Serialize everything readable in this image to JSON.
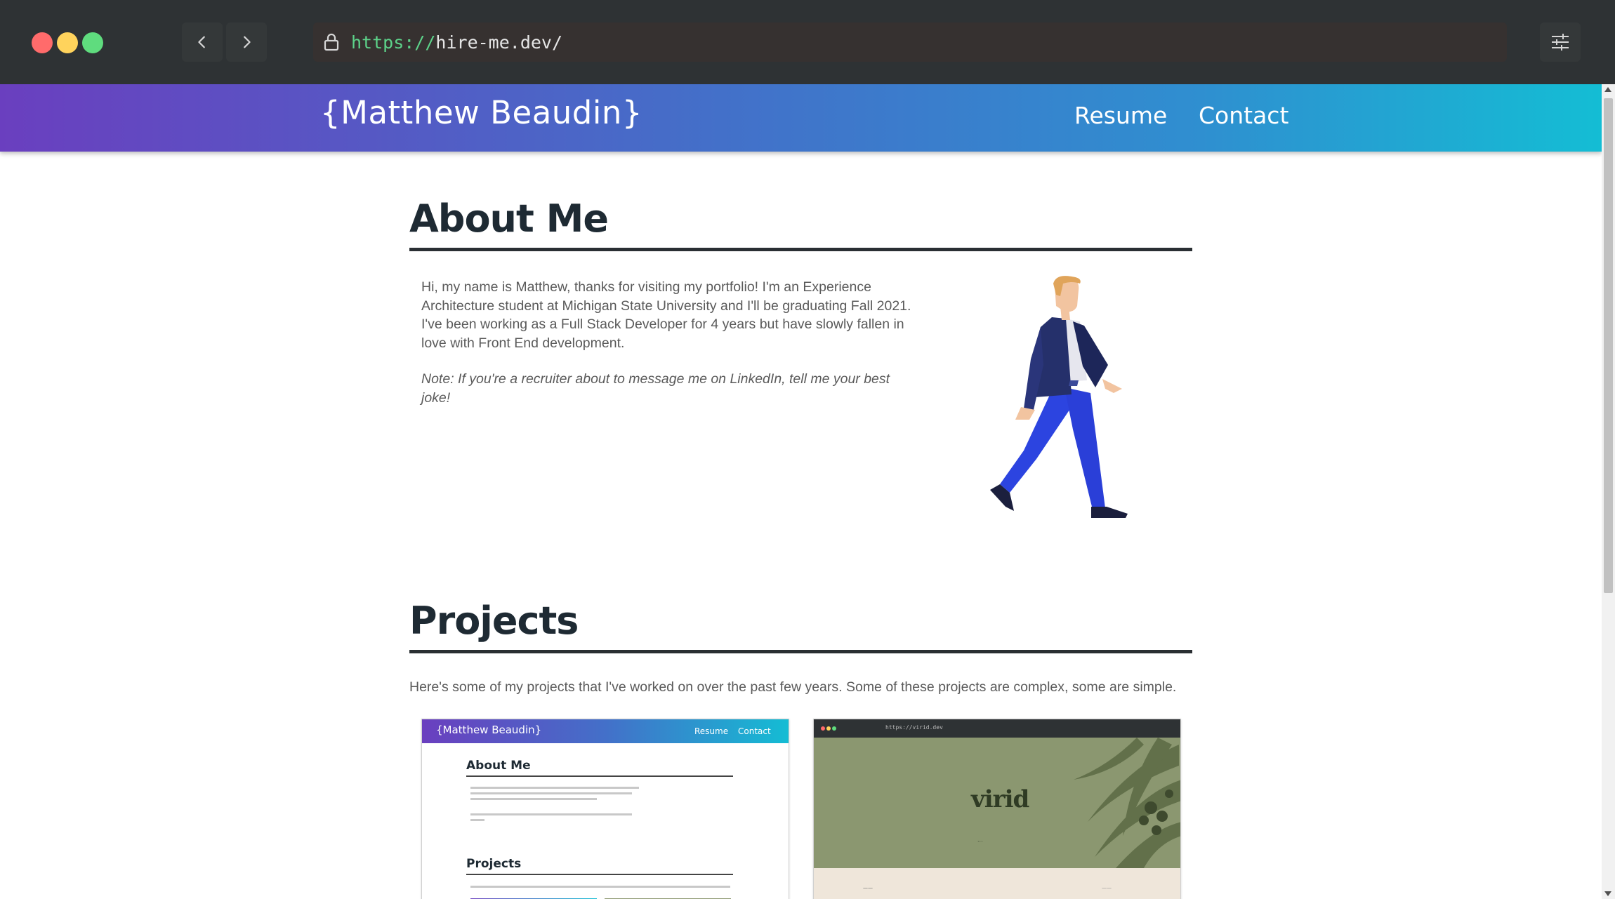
{
  "browser": {
    "url_scheme": "https://",
    "url_host": "hire-me.dev/",
    "icons": [
      "back-icon",
      "forward-icon",
      "lock-icon",
      "settings-sliders-icon"
    ]
  },
  "site": {
    "brand": "{Matthew Beaudin}",
    "nav": {
      "resume": "Resume",
      "contact": "Contact"
    }
  },
  "about": {
    "title": "About Me",
    "text": "Hi, my name is Matthew, thanks for visiting my portfolio! I'm an Experience Architecture student at Michigan State University and I'll be graduating Fall 2021. I've been working as a Full Stack Developer for 4 years but have slowly fallen in love with Front End development.",
    "note": "Note: If you're a recruiter about to message me on LinkedIn, tell me your best joke!"
  },
  "projects": {
    "title": "Projects",
    "intro": "Here's some of my projects that I've worked on over the past few years. Some of these projects are complex, some are simple.",
    "cards": [
      {
        "brand": "{Matthew Beaudin}",
        "nav_resume": "Resume",
        "nav_contact": "Contact",
        "about_title": "About Me",
        "projects_title": "Projects"
      },
      {
        "logo": "virid",
        "url": "https://virid.dev"
      }
    ]
  },
  "colors": {
    "header_gradient_start": "#6a3fbf",
    "header_gradient_end": "#14bdd4",
    "heading": "#1e2a33",
    "body_text": "#5a5a5a",
    "url_scheme": "#5dd38a",
    "chrome_bg": "#2e3234"
  }
}
